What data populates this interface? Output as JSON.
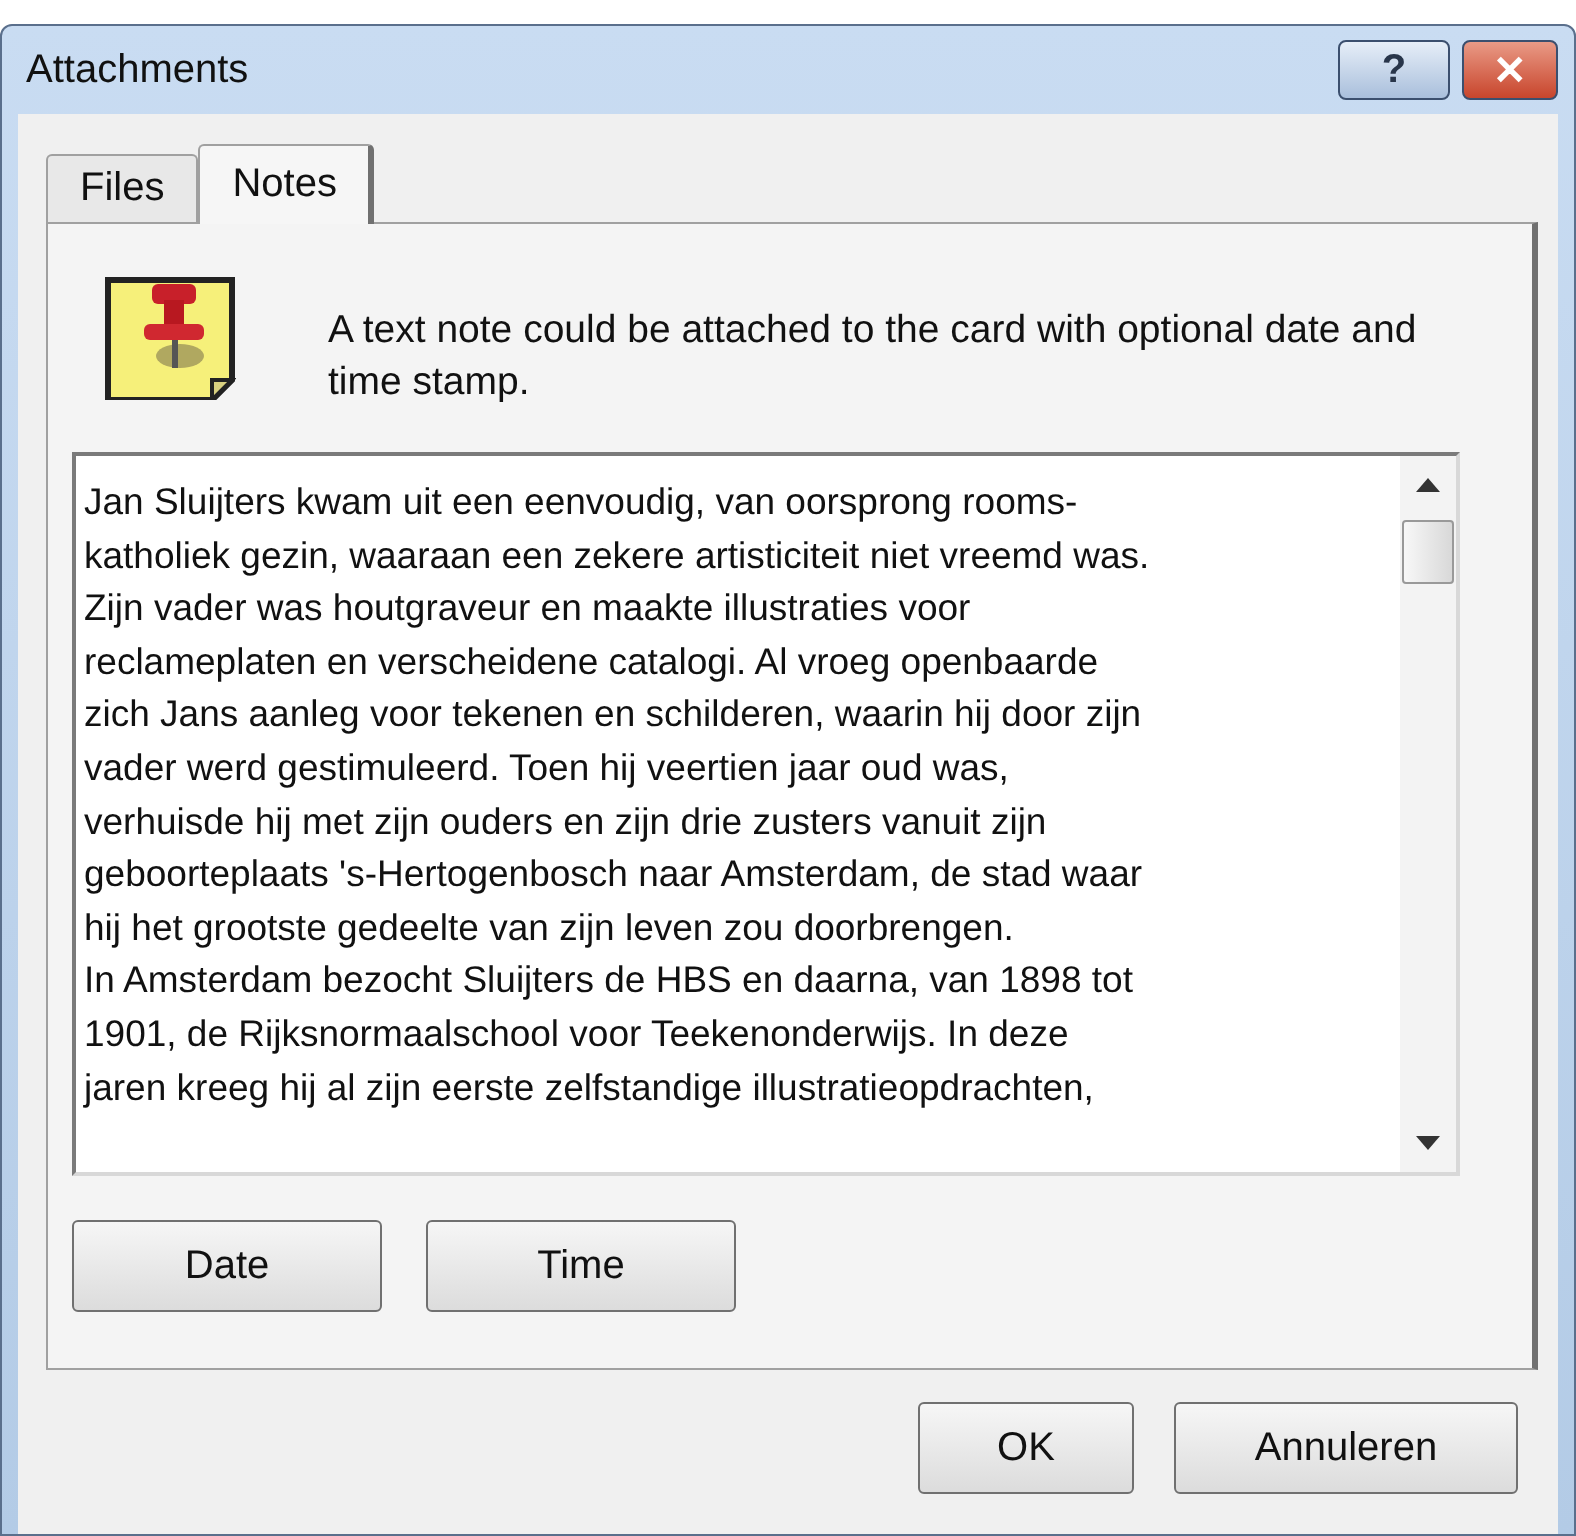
{
  "window": {
    "title": "Attachments",
    "buttons": [
      {
        "kind": "help",
        "label": "?"
      },
      {
        "kind": "close",
        "label": "✕"
      }
    ]
  },
  "tabs": [
    {
      "label": "Files",
      "selected": false
    },
    {
      "label": "Notes",
      "selected": true
    }
  ],
  "description": "A text note could be attached to the card with optional date and time stamp.",
  "note": {
    "lines": [
      "Jan Sluijters kwam uit een eenvoudig, van oorsprong rooms-",
      "katholiek gezin, waaraan een zekere artisticiteit niet vreemd was.",
      "Zijn vader was houtgraveur en maakte illustraties voor",
      "reclameplaten en verscheidene catalogi. Al vroeg openbaarde",
      "zich Jans aanleg voor tekenen en schilderen, waarin hij door zijn",
      "vader werd gestimuleerd. Toen hij veertien jaar oud was,",
      "verhuisde hij met zijn ouders en zijn drie zusters vanuit zijn",
      "geboorteplaats 's-Hertogenbosch naar Amsterdam, de stad waar",
      "hij het grootste gedeelte van zijn leven zou doorbrengen.",
      "In Amsterdam bezocht Sluijters de HBS en daarna, van 1898 tot",
      "1901, de Rijksnormaalschool voor Teekenonderwijs. In deze",
      "jaren kreeg hij al zijn eerste zelfstandige illustratieopdrachten,"
    ]
  },
  "stamp_buttons": [
    "Date",
    "Time"
  ],
  "footer_buttons": [
    "OK",
    "Annuleren"
  ]
}
